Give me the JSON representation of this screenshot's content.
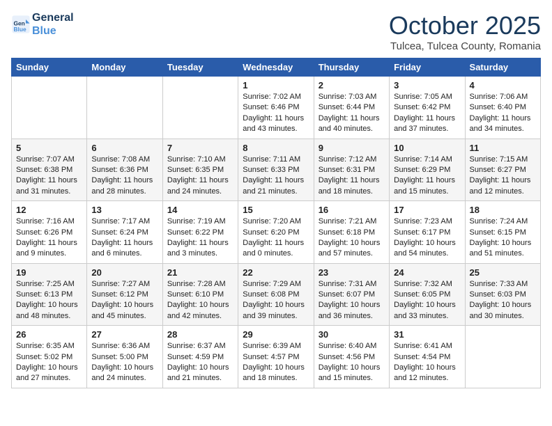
{
  "logo": {
    "line1": "General",
    "line2": "Blue"
  },
  "title": "October 2025",
  "subtitle": "Tulcea, Tulcea County, Romania",
  "days_of_week": [
    "Sunday",
    "Monday",
    "Tuesday",
    "Wednesday",
    "Thursday",
    "Friday",
    "Saturday"
  ],
  "weeks": [
    [
      {
        "day": "",
        "content": ""
      },
      {
        "day": "",
        "content": ""
      },
      {
        "day": "",
        "content": ""
      },
      {
        "day": "1",
        "content": "Sunrise: 7:02 AM\nSunset: 6:46 PM\nDaylight: 11 hours\nand 43 minutes."
      },
      {
        "day": "2",
        "content": "Sunrise: 7:03 AM\nSunset: 6:44 PM\nDaylight: 11 hours\nand 40 minutes."
      },
      {
        "day": "3",
        "content": "Sunrise: 7:05 AM\nSunset: 6:42 PM\nDaylight: 11 hours\nand 37 minutes."
      },
      {
        "day": "4",
        "content": "Sunrise: 7:06 AM\nSunset: 6:40 PM\nDaylight: 11 hours\nand 34 minutes."
      }
    ],
    [
      {
        "day": "5",
        "content": "Sunrise: 7:07 AM\nSunset: 6:38 PM\nDaylight: 11 hours\nand 31 minutes."
      },
      {
        "day": "6",
        "content": "Sunrise: 7:08 AM\nSunset: 6:36 PM\nDaylight: 11 hours\nand 28 minutes."
      },
      {
        "day": "7",
        "content": "Sunrise: 7:10 AM\nSunset: 6:35 PM\nDaylight: 11 hours\nand 24 minutes."
      },
      {
        "day": "8",
        "content": "Sunrise: 7:11 AM\nSunset: 6:33 PM\nDaylight: 11 hours\nand 21 minutes."
      },
      {
        "day": "9",
        "content": "Sunrise: 7:12 AM\nSunset: 6:31 PM\nDaylight: 11 hours\nand 18 minutes."
      },
      {
        "day": "10",
        "content": "Sunrise: 7:14 AM\nSunset: 6:29 PM\nDaylight: 11 hours\nand 15 minutes."
      },
      {
        "day": "11",
        "content": "Sunrise: 7:15 AM\nSunset: 6:27 PM\nDaylight: 11 hours\nand 12 minutes."
      }
    ],
    [
      {
        "day": "12",
        "content": "Sunrise: 7:16 AM\nSunset: 6:26 PM\nDaylight: 11 hours\nand 9 minutes."
      },
      {
        "day": "13",
        "content": "Sunrise: 7:17 AM\nSunset: 6:24 PM\nDaylight: 11 hours\nand 6 minutes."
      },
      {
        "day": "14",
        "content": "Sunrise: 7:19 AM\nSunset: 6:22 PM\nDaylight: 11 hours\nand 3 minutes."
      },
      {
        "day": "15",
        "content": "Sunrise: 7:20 AM\nSunset: 6:20 PM\nDaylight: 11 hours\nand 0 minutes."
      },
      {
        "day": "16",
        "content": "Sunrise: 7:21 AM\nSunset: 6:18 PM\nDaylight: 10 hours\nand 57 minutes."
      },
      {
        "day": "17",
        "content": "Sunrise: 7:23 AM\nSunset: 6:17 PM\nDaylight: 10 hours\nand 54 minutes."
      },
      {
        "day": "18",
        "content": "Sunrise: 7:24 AM\nSunset: 6:15 PM\nDaylight: 10 hours\nand 51 minutes."
      }
    ],
    [
      {
        "day": "19",
        "content": "Sunrise: 7:25 AM\nSunset: 6:13 PM\nDaylight: 10 hours\nand 48 minutes."
      },
      {
        "day": "20",
        "content": "Sunrise: 7:27 AM\nSunset: 6:12 PM\nDaylight: 10 hours\nand 45 minutes."
      },
      {
        "day": "21",
        "content": "Sunrise: 7:28 AM\nSunset: 6:10 PM\nDaylight: 10 hours\nand 42 minutes."
      },
      {
        "day": "22",
        "content": "Sunrise: 7:29 AM\nSunset: 6:08 PM\nDaylight: 10 hours\nand 39 minutes."
      },
      {
        "day": "23",
        "content": "Sunrise: 7:31 AM\nSunset: 6:07 PM\nDaylight: 10 hours\nand 36 minutes."
      },
      {
        "day": "24",
        "content": "Sunrise: 7:32 AM\nSunset: 6:05 PM\nDaylight: 10 hours\nand 33 minutes."
      },
      {
        "day": "25",
        "content": "Sunrise: 7:33 AM\nSunset: 6:03 PM\nDaylight: 10 hours\nand 30 minutes."
      }
    ],
    [
      {
        "day": "26",
        "content": "Sunrise: 6:35 AM\nSunset: 5:02 PM\nDaylight: 10 hours\nand 27 minutes."
      },
      {
        "day": "27",
        "content": "Sunrise: 6:36 AM\nSunset: 5:00 PM\nDaylight: 10 hours\nand 24 minutes."
      },
      {
        "day": "28",
        "content": "Sunrise: 6:37 AM\nSunset: 4:59 PM\nDaylight: 10 hours\nand 21 minutes."
      },
      {
        "day": "29",
        "content": "Sunrise: 6:39 AM\nSunset: 4:57 PM\nDaylight: 10 hours\nand 18 minutes."
      },
      {
        "day": "30",
        "content": "Sunrise: 6:40 AM\nSunset: 4:56 PM\nDaylight: 10 hours\nand 15 minutes."
      },
      {
        "day": "31",
        "content": "Sunrise: 6:41 AM\nSunset: 4:54 PM\nDaylight: 10 hours\nand 12 minutes."
      },
      {
        "day": "",
        "content": ""
      }
    ]
  ]
}
